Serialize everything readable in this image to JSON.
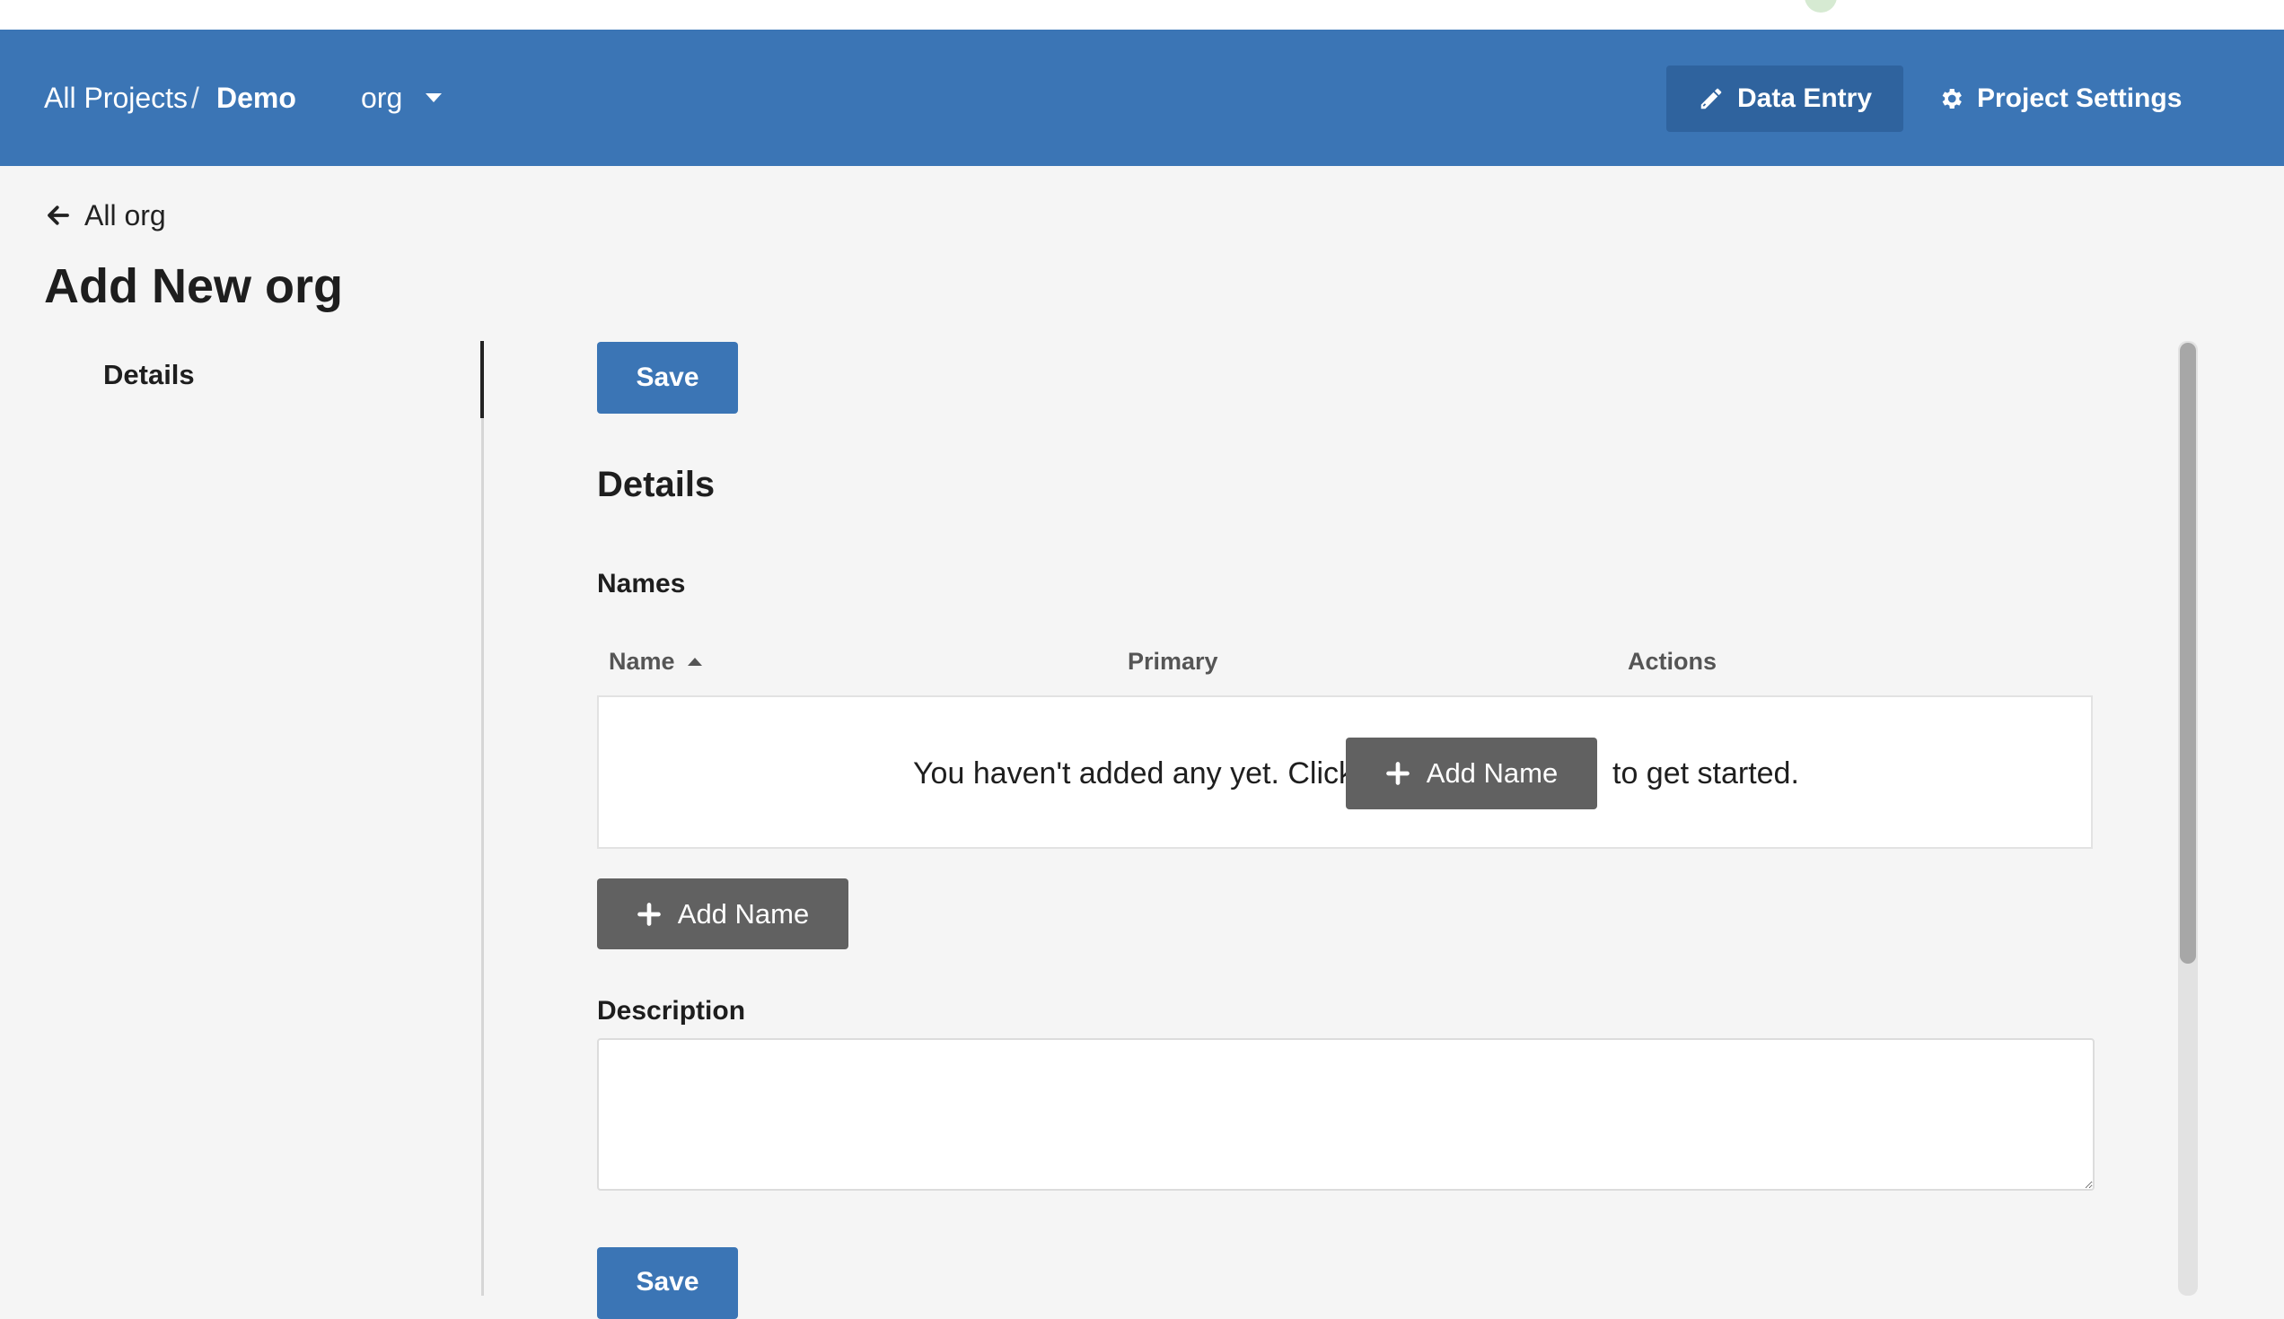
{
  "navbar": {
    "breadcrumb_all": "All Projects",
    "breadcrumb_sep": "/",
    "breadcrumb_project": "Demo",
    "type_selector": "org",
    "data_entry_label": "Data Entry",
    "project_settings_label": "Project Settings",
    "color": "#3b75b5",
    "active_color": "#2f639e"
  },
  "page": {
    "back_label": "All org",
    "title": "Add New org"
  },
  "sidebar": {
    "items": [
      {
        "label": "Details",
        "active": true
      }
    ]
  },
  "form": {
    "save_label": "Save",
    "section_title": "Details",
    "names": {
      "label": "Names",
      "columns": [
        "Name",
        "Primary",
        "Actions"
      ],
      "sorted_column": "Name",
      "sort_direction": "ascending",
      "empty_prefix": "You haven't added any yet. Click",
      "empty_suffix": "to get started.",
      "add_label": "Add Name"
    },
    "description": {
      "label": "Description",
      "value": ""
    }
  },
  "icons": {
    "back": "arrow-left-icon",
    "data_entry": "pencil-icon",
    "settings": "gear-icon",
    "add": "plus-icon",
    "dropdown": "caret-down-icon",
    "sort": "caret-up-icon"
  }
}
